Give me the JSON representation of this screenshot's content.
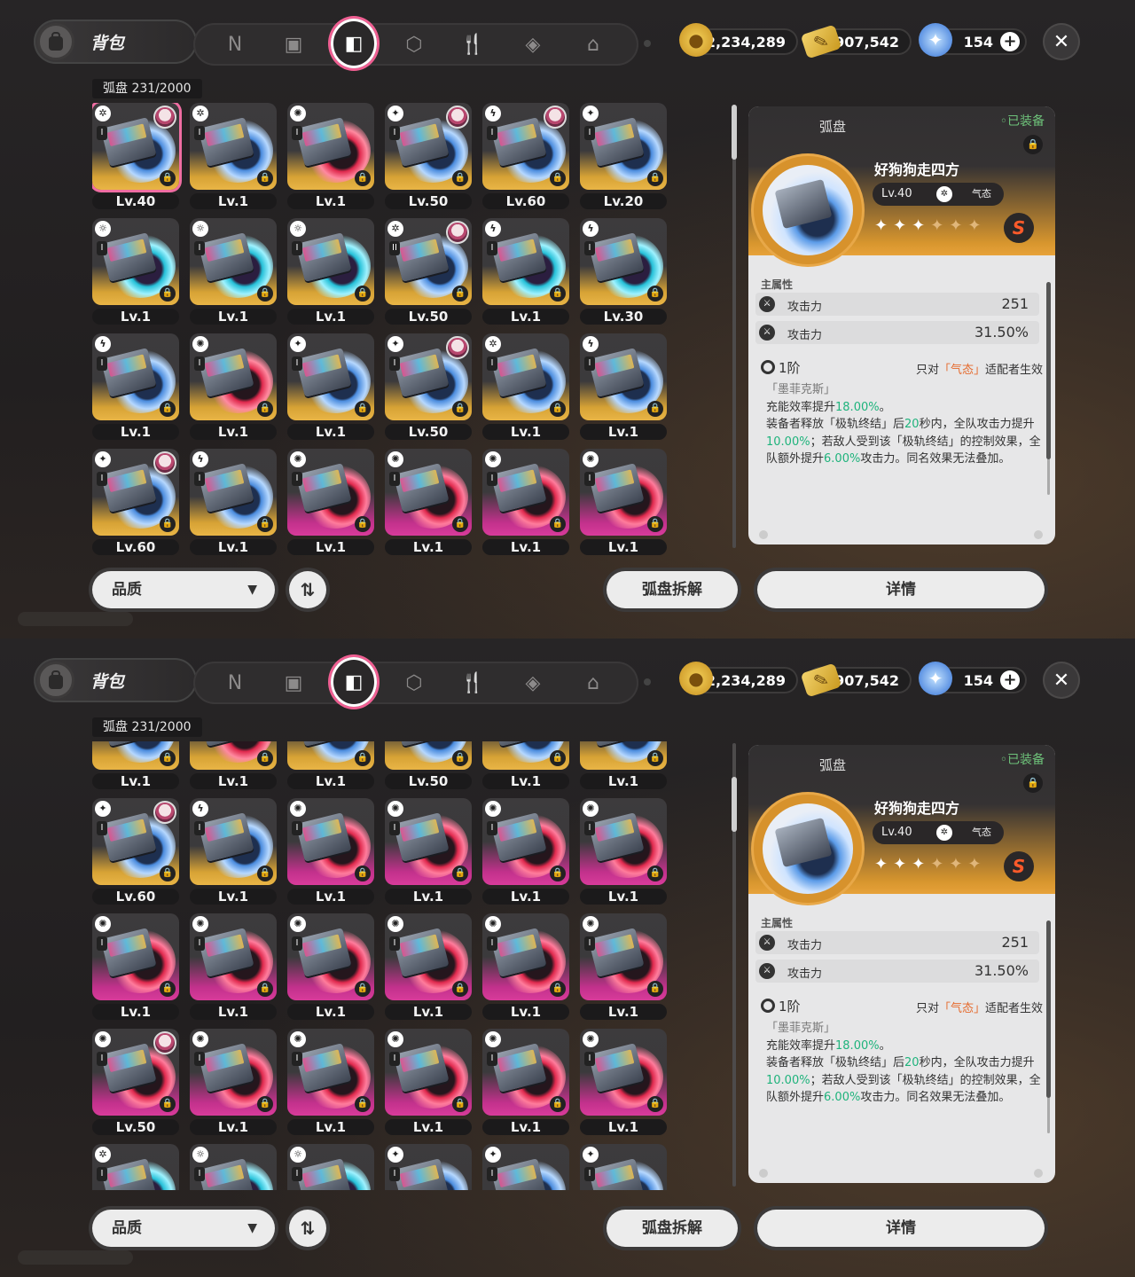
{
  "top": {
    "bag_title": "背包",
    "tabs": [
      {
        "name": "tab-agents",
        "icon": "N"
      },
      {
        "name": "tab-bangboo",
        "icon": "▣"
      },
      {
        "name": "tab-drive-disc",
        "icon": "◧",
        "active": true
      },
      {
        "name": "tab-materials",
        "icon": "⬡"
      },
      {
        "name": "tab-food",
        "icon": "🍴"
      },
      {
        "name": "tab-items",
        "icon": "◈"
      },
      {
        "name": "tab-home",
        "icon": "⌂"
      }
    ],
    "currency": {
      "dennies": "2,234,289",
      "film": "907,542",
      "polychrome": "154",
      "plus": "+"
    },
    "close": "✕"
  },
  "inventory": {
    "category": "弧盘",
    "count": "231/2000",
    "quality_filter": "品质",
    "sort_icon": "⇅",
    "dismantle": "弧盘拆解",
    "details": "详情",
    "screen1_cards": [
      {
        "lv": "Lv.40",
        "el": "✲",
        "rk": "I",
        "rar": "gold",
        "ring": "",
        "av": true,
        "sel": true
      },
      {
        "lv": "Lv.1",
        "el": "✲",
        "rk": "I",
        "rar": "gold",
        "ring": ""
      },
      {
        "lv": "Lv.1",
        "el": "✺",
        "rk": "I",
        "rar": "gold",
        "ring": "r"
      },
      {
        "lv": "Lv.50",
        "el": "✦",
        "rk": "I",
        "rar": "gold",
        "ring": "",
        "av": true
      },
      {
        "lv": "Lv.60",
        "el": "ϟ",
        "rk": "I",
        "rar": "gold",
        "ring": "",
        "av": true
      },
      {
        "lv": "Lv.20",
        "el": "✦",
        "rk": "I",
        "rar": "gold",
        "ring": ""
      },
      {
        "lv": "Lv.1",
        "el": "☼",
        "rk": "I",
        "rar": "gold",
        "ring": "c"
      },
      {
        "lv": "Lv.1",
        "el": "☼",
        "rk": "I",
        "rar": "gold",
        "ring": "c"
      },
      {
        "lv": "Lv.1",
        "el": "☼",
        "rk": "I",
        "rar": "gold",
        "ring": "c"
      },
      {
        "lv": "Lv.50",
        "el": "✲",
        "rk": "II",
        "rar": "gold",
        "ring": "",
        "av": true
      },
      {
        "lv": "Lv.1",
        "el": "ϟ",
        "rk": "I",
        "rar": "gold",
        "ring": "c"
      },
      {
        "lv": "Lv.30",
        "el": "ϟ",
        "rk": "I",
        "rar": "gold",
        "ring": "c"
      },
      {
        "lv": "Lv.1",
        "el": "ϟ",
        "rk": "I",
        "rar": "gold",
        "ring": ""
      },
      {
        "lv": "Lv.1",
        "el": "✺",
        "rk": "I",
        "rar": "gold",
        "ring": "r"
      },
      {
        "lv": "Lv.1",
        "el": "✦",
        "rk": "I",
        "rar": "gold",
        "ring": ""
      },
      {
        "lv": "Lv.50",
        "el": "✦",
        "rk": "I",
        "rar": "gold",
        "ring": "",
        "av": true
      },
      {
        "lv": "Lv.1",
        "el": "✲",
        "rk": "I",
        "rar": "gold",
        "ring": ""
      },
      {
        "lv": "Lv.1",
        "el": "ϟ",
        "rk": "I",
        "rar": "gold",
        "ring": ""
      },
      {
        "lv": "Lv.60",
        "el": "✦",
        "rk": "I",
        "rar": "gold",
        "ring": "",
        "av": true
      },
      {
        "lv": "Lv.1",
        "el": "ϟ",
        "rk": "I",
        "rar": "gold",
        "ring": ""
      },
      {
        "lv": "Lv.1",
        "el": "✺",
        "rk": "I",
        "rar": "pink",
        "ring": ""
      },
      {
        "lv": "Lv.1",
        "el": "✺",
        "rk": "I",
        "rar": "pink",
        "ring": ""
      },
      {
        "lv": "Lv.1",
        "el": "✺",
        "rk": "I",
        "rar": "pink",
        "ring": ""
      },
      {
        "lv": "Lv.1",
        "el": "✺",
        "rk": "I",
        "rar": "pink",
        "ring": ""
      }
    ],
    "screen2_cards": [
      {
        "lv": "Lv.1",
        "el": "ϟ",
        "rk": "I",
        "rar": "gold",
        "ring": ""
      },
      {
        "lv": "Lv.1",
        "el": "✺",
        "rk": "I",
        "rar": "gold",
        "ring": "r"
      },
      {
        "lv": "Lv.1",
        "el": "✦",
        "rk": "I",
        "rar": "gold",
        "ring": ""
      },
      {
        "lv": "Lv.50",
        "el": "✦",
        "rk": "I",
        "rar": "gold",
        "ring": ""
      },
      {
        "lv": "Lv.1",
        "el": "✲",
        "rk": "I",
        "rar": "gold",
        "ring": ""
      },
      {
        "lv": "Lv.1",
        "el": "ϟ",
        "rk": "I",
        "rar": "gold",
        "ring": ""
      },
      {
        "lv": "Lv.60",
        "el": "✦",
        "rk": "I",
        "rar": "gold",
        "ring": "",
        "av": true
      },
      {
        "lv": "Lv.1",
        "el": "ϟ",
        "rk": "I",
        "rar": "gold",
        "ring": ""
      },
      {
        "lv": "Lv.1",
        "el": "✺",
        "rk": "I",
        "rar": "pink",
        "ring": ""
      },
      {
        "lv": "Lv.1",
        "el": "✺",
        "rk": "I",
        "rar": "pink",
        "ring": ""
      },
      {
        "lv": "Lv.1",
        "el": "✺",
        "rk": "I",
        "rar": "pink",
        "ring": ""
      },
      {
        "lv": "Lv.1",
        "el": "✺",
        "rk": "I",
        "rar": "pink",
        "ring": ""
      },
      {
        "lv": "Lv.1",
        "el": "✺",
        "rk": "I",
        "rar": "pink",
        "ring": ""
      },
      {
        "lv": "Lv.1",
        "el": "✺",
        "rk": "I",
        "rar": "pink",
        "ring": ""
      },
      {
        "lv": "Lv.1",
        "el": "✺",
        "rk": "I",
        "rar": "pink",
        "ring": ""
      },
      {
        "lv": "Lv.1",
        "el": "✺",
        "rk": "I",
        "rar": "pink",
        "ring": ""
      },
      {
        "lv": "Lv.1",
        "el": "✺",
        "rk": "I",
        "rar": "pink",
        "ring": ""
      },
      {
        "lv": "Lv.1",
        "el": "✺",
        "rk": "I",
        "rar": "pink",
        "ring": ""
      },
      {
        "lv": "Lv.50",
        "el": "✺",
        "rk": "I",
        "rar": "pink",
        "ring": "",
        "av": true
      },
      {
        "lv": "Lv.1",
        "el": "✺",
        "rk": "I",
        "rar": "pink",
        "ring": ""
      },
      {
        "lv": "Lv.1",
        "el": "✺",
        "rk": "I",
        "rar": "pink",
        "ring": ""
      },
      {
        "lv": "Lv.1",
        "el": "✺",
        "rk": "I",
        "rar": "pink",
        "ring": ""
      },
      {
        "lv": "Lv.1",
        "el": "✺",
        "rk": "I",
        "rar": "pink",
        "ring": ""
      },
      {
        "lv": "Lv.1",
        "el": "✺",
        "rk": "I",
        "rar": "pink",
        "ring": ""
      },
      {
        "lv": "",
        "el": "✲",
        "rk": "I",
        "rar": "gold",
        "ring": "c"
      },
      {
        "lv": "",
        "el": "☼",
        "rk": "I",
        "rar": "gold",
        "ring": "c"
      },
      {
        "lv": "",
        "el": "☼",
        "rk": "I",
        "rar": "gold",
        "ring": "c"
      },
      {
        "lv": "",
        "el": "✦",
        "rk": "I",
        "rar": "gold",
        "ring": ""
      },
      {
        "lv": "",
        "el": "✦",
        "rk": "I",
        "rar": "gold",
        "ring": ""
      },
      {
        "lv": "",
        "el": "✦",
        "rk": "I",
        "rar": "gold",
        "ring": ""
      }
    ]
  },
  "detail": {
    "category": "弧盘",
    "equipped": "◦已装备",
    "name": "好狗狗走四方",
    "level": "Lv.40",
    "element_text": "气态",
    "rank_letter": "S",
    "stars_lit": 3,
    "stars_total": 6,
    "main_stat_title": "主属性",
    "stat1_label": "攻击力",
    "stat1_value": "251",
    "stat2_label": "攻击力",
    "stat2_value": "31.50%",
    "tier": "1阶",
    "tier_note_pre": "只对",
    "tier_note_em": "「气态」",
    "tier_note_post": "适配者生效",
    "passive_name": "「墨菲克斯」",
    "line1_a": "充能效率提升",
    "line1_g": "18.00%",
    "line1_b": "。",
    "line2_a": "装备者释放「极轨终结」后",
    "line2_g": "20",
    "line2_b": "秒内，全队攻击力提升",
    "line2_g2": "10.00%",
    "line2_c": "；若敌人受到该「极轨终结」的控制效果，全队额外提升",
    "line2_g3": "6.00%",
    "line2_d": "攻击力。同名效果无法叠加。"
  },
  "colors": {
    "accent_pink": "#ef5f92",
    "rarity_gold": "#e2ad3f",
    "rarity_pink": "#d13a95",
    "stat_green": "#1fb37c",
    "note_orange": "#e56a2c"
  }
}
